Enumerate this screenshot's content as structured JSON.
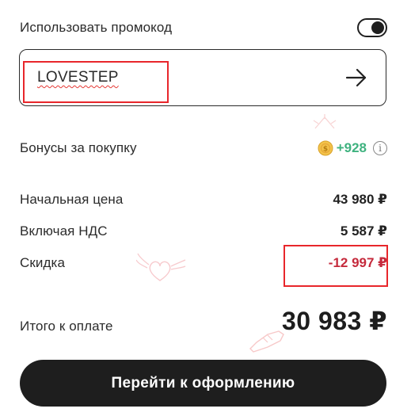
{
  "promo": {
    "toggle_label": "Использовать промокод",
    "toggle_on": true,
    "code_value": "LOVESTEP"
  },
  "bonuses": {
    "label": "Бонусы за покупку",
    "value": "+928",
    "info_icon": "i"
  },
  "summary": {
    "initial_label": "Начальная цена",
    "initial_value": "43 980 ₽",
    "vat_label": "Включая НДС",
    "vat_value": "5 587 ₽",
    "discount_label": "Скидка",
    "discount_value": "-12 997 ₽",
    "total_label": "Итого к оплате",
    "total_value": "30 983 ₽"
  },
  "checkout": {
    "label": "Перейти к оформлению"
  },
  "colors": {
    "bonus_green": "#3fb27f",
    "discount_red": "#c52a3c",
    "highlight_red": "#e8262b",
    "button_dark": "#1e1e1e"
  },
  "icons": [
    "toggle-switch",
    "arrow-right-icon",
    "coin-icon",
    "info-icon"
  ]
}
